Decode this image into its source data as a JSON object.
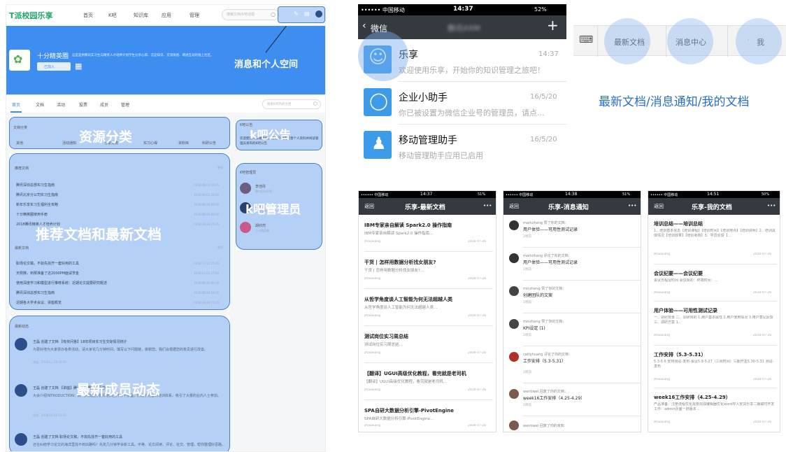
{
  "web": {
    "logo": "T派校园乐享",
    "nav": [
      "首页",
      "K吧",
      "知识库",
      "应用",
      "管理"
    ],
    "search_placeholder": "搜索文档/K吧话题",
    "banner_name": "十分精英圈",
    "banner_desc": "这是是供腾讯实习生与精英人才培养计划学生分享心得、沉淀知识、交流情感、增进互动的线上社区。",
    "banner_joined": "已加入",
    "banner_label": "消息和个人空间",
    "tabs": [
      "首页",
      "文档",
      "活动",
      "投票",
      "成员",
      "管理"
    ],
    "tab_search_placeholder": "搜索K吧内的文档",
    "cat_title": "文档分类",
    "cats": [
      "其他",
      "活动通知",
      "分享交流",
      "实习心得",
      "资料库",
      "科研公告"
    ],
    "cat_label": "资源分类",
    "notice_title": "K吧公告",
    "notice_text": "欢迎使用十分精英圈，新用户请先完善个人资料并阅读管理员发布的K吧公告",
    "notice_label": "k吧公告",
    "rec_title": "推荐文档",
    "rec_more": "更多",
    "rec_rows": [
      {
        "t": "腾讯深圳总部实习生指南",
        "d": "2018-08-02 18:35"
      },
      {
        "t": "腾讯北京分公司实习生指南",
        "d": "2018-08-01 16:20"
      },
      {
        "t": "新年乐享实习生福利全攻略",
        "d": "2018-08-26 09:50"
      },
      {
        "t": "十分精英圈使用手册",
        "d": "2018-08-26 09:50"
      },
      {
        "t": "2018腾讯精英人才培养计划",
        "d": "2018-08-26 16:15"
      }
    ],
    "new_title": "最新文档",
    "new_rows": [
      {
        "t": "职场论文稿，不如先找齐一套好用的工具",
        "d": "2018-11-12 15:40"
      },
      {
        "t": "天刚擦，到那准备了这2000PM面试学金",
        "d": "2018-11-01 17:03"
      },
      {
        "t": "使用深度学习和模型进行推荐系统：近期论文提要研究概述",
        "d": "2018-08-31 09:06"
      },
      {
        "t": "腾讯深圳总部实习生指南",
        "d": "2018-08-30 16:15"
      },
      {
        "t": "近期各大学术会议、讲座概览",
        "d": "2018-08-29 15:10"
      }
    ],
    "doc_label": "推荐文档和最新文档",
    "admin_title": "K吧管理员",
    "admins": [
      {
        "n": "李佳彤",
        "r": "腾讯培训学院"
      },
      {
        "n": "王磊",
        "r": "腾讯培训学院"
      },
      {
        "n": "胡欣然",
        "r": "十分精英圈"
      }
    ],
    "admin_label": "k吧管理员",
    "activity_title": "最新动态",
    "activities": [
      {
        "h": "王磊 创建了文档 【有奖问答】18年项目实习生交际情况统计",
        "b": "为更好地为大家举办各类活动，请大家花几分钟时间，填写以下问题链，谢谢您。我们会根据您的意见进行改善。",
        "m": "浏览 · 2018-11-20 16:30"
      },
      {
        "h": "王磊 创建了文档 【讲座】腾讯大数据分析师培训",
        "b": "大会介绍INTRODUCTION：腾讯大数据分析师培训已开办十余届，形成了完善的培训体系，吸引了大量的业内人士参加。",
        "m": "浏览 · 2018-10-28 12:23"
      },
      {
        "h": "王磊 创建了文档 职场论文稿，不如先找齐一套好用的工具",
        "b": "还在纠结学习论文的海洋里找不到出路吗？先花几分钟学会新工具。平等、论文阅读、评论、社交、管理，帮你整理好思路。",
        "m": ""
      }
    ],
    "activity_label": "最新成员动态"
  },
  "chat": {
    "carrier": "•••••• 中国移动",
    "time": "14:37",
    "battery": "52%",
    "back": "微信",
    "title": "腾讯XXM",
    "plus": "+",
    "items": [
      {
        "n": "乐享",
        "d": "14:37",
        "s": "欢迎使用乐享，开始你的知识管理之旅吧！"
      },
      {
        "n": "企业小助手",
        "d": "16/5/20",
        "s": "你已被设置为微信企业号的管理员，请点..."
      },
      {
        "n": "移动管理助手",
        "d": "16/5/20",
        "s": "移动管理助手应用已启用"
      }
    ]
  },
  "tabs": {
    "items": [
      "最新文档",
      "消息中心",
      "我"
    ],
    "caption": "最新文档/消息通知/我的文档"
  },
  "phone1": {
    "carrier": "•••••• 中国移动",
    "time": "14:37",
    "battery": "51%",
    "back": "返回",
    "title": "乐享-最新文档",
    "more": "•••",
    "items": [
      {
        "t": "IBM专家亲自解读 Spark2.0 操作指南",
        "s": "IBM专家亲自解读 Spark2.0 操作指南...",
        "m": "zhaoxiang",
        "d": "2016-07-26"
      },
      {
        "t": "干货 | 怎样用数据分析找女朋友?",
        "s": "干货 | 怎样用数据分析找女朋友?...",
        "m": "zhaoxiang",
        "d": "2016-07-26"
      },
      {
        "t": "从哲学角度谈人工智能为何无法超越人类",
        "s": "从哲学角度谈人工智能为何无法超越人类...",
        "m": "zhaoxiang",
        "d": "2016-07-26"
      },
      {
        "t": "测试岗位实习周总结",
        "s": "测试岗位实习周总结...",
        "m": "zhaoxiang",
        "d": "2016-07-26"
      },
      {
        "t": "【翻译】UGUI高级优化教程，看完就是老司机",
        "s": "【翻译】UGUI高级优化教程，看完就是老司机...",
        "m": "zhaoxiang",
        "d": "2016-07-26"
      },
      {
        "t": "SPA自研大数据分析引擎-PivotEngine",
        "s": "SPA自研大数据分析引擎-PivotEngine...",
        "m": "zhaoxiang",
        "d": "2016-07-26"
      }
    ]
  },
  "phone2": {
    "carrier": "•••••• 中国移动",
    "time": "14:38",
    "battery": "51%",
    "back": "返回",
    "title": "乐享-消息通知",
    "more": "•••",
    "items": [
      {
        "a": "markzhang 赞了你的文档：",
        "t": "用户体验——可用性测试记录",
        "m": "2周前"
      },
      {
        "a": "markzhang 评论了你的文档：",
        "t": "用户体验——可用性测试记录",
        "m": "2周前"
      },
      {
        "a": "minzheng 赞了你的文档：",
        "t": "创建团队的文案",
        "m": "2周前"
      },
      {
        "a": "minzheng 赞了你的文档：",
        "t": "KPI设定 (1)",
        "m": "2周前"
      },
      {
        "a": "cattyhuang 评论了你的文档：",
        "t": "工作安排（5.3-5.31）",
        "m": "2周前"
      },
      {
        "a": "wentiwei 回复了你的文档：",
        "t": "week16工作安排（4.25-4.29）",
        "m": "2周前"
      },
      {
        "a": "wentiwei 回复了你的未知",
        "t": "",
        "m": ""
      }
    ]
  },
  "phone3": {
    "carrier": "•••••• 中国移动",
    "time": "14:51",
    "battery": "50%",
    "back": "返回",
    "title": "乐享-我的文档",
    "more": "•••",
    "items": [
      {
        "t": "培训总结——培训总结",
        "s": "1、培训基本信息【培训课程】【培训时间】【培训地点】【培训讲师】2、培训具体情况【培训效果】【培训考核】3、学员反馈【...",
        "m": "zhaoxiang",
        "d": "2016-07-26"
      },
      {
        "t": "会议纪要——会议纪要",
        "s": "会议日程及时间 会议目的：终端时间：...",
        "m": "zhaoxiang",
        "d": "2016-07-26"
      },
      {
        "t": "用户体验——可用性测试记录",
        "s": "一、调研背景 二、调研目的 1.用户基本属性 2.用户使用情况 3.用户意见反馈 三、调研方案 1...",
        "m": "zhaoxiang",
        "d": "2016-07-26"
      },
      {
        "t": "工作安排（5.3-5.31）",
        "s": "5.3-5.6 安排测试-发布-会议5.9-5.27（三周时间）三期开发5.30-5.31 测试-发布",
        "m": "zhaoxiang",
        "d": "2016-07-26"
      },
      {
        "t": "week16工作安排（4.25-4.29）",
        "s": "产品准备：注册流程优化需要完成编辑器优化word导入安货乐享二期或时开发工作：admin页面一旧版本 ...",
        "m": "zhaoxiang",
        "d": "2016-07-26"
      }
    ]
  }
}
